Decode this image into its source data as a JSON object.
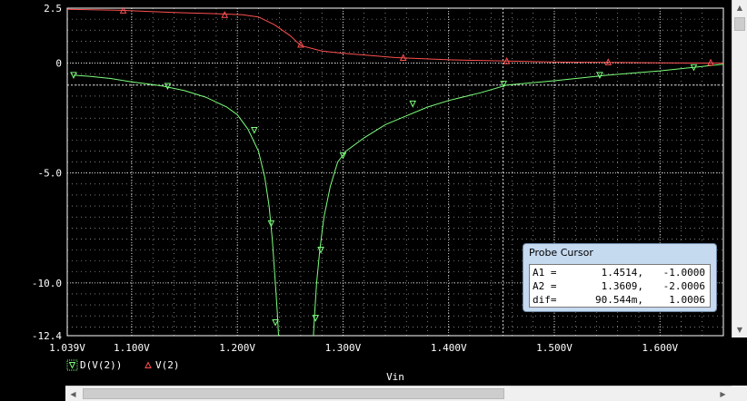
{
  "colors": {
    "background": "#000000",
    "grid": "#ffffff",
    "derivative_trace": "#7cff7c",
    "voltage_trace": "#ff5050",
    "cursor_line": "#ffffff",
    "probe_panel": "#c5d9ef"
  },
  "chart_data": {
    "type": "line",
    "xlabel": "Vin",
    "ylabel": "",
    "xlim": [
      1.039,
      1.66
    ],
    "ylim": [
      -12.4,
      2.5
    ],
    "grid": true,
    "legend_placement": "bottom-left",
    "x_tick_values": [
      1.1,
      1.2,
      1.3,
      1.4,
      1.5,
      1.6
    ],
    "x_tick_labels": [
      "1.039V",
      "1.100V",
      "1.200V",
      "1.300V",
      "1.400V",
      "1.500V",
      "1.600V"
    ],
    "x_label_values": [
      1.039,
      1.1,
      1.2,
      1.3,
      1.4,
      1.5,
      1.6
    ],
    "y_tick_values": [
      2.5,
      0,
      -5.0,
      -10.0,
      -12.4
    ],
    "y_tick_labels": [
      "2.5",
      "0",
      "-5.0",
      "-10.0",
      "-12.4"
    ],
    "cursors": [
      {
        "name": "A1",
        "x": 1.4514,
        "y": -1.0
      },
      {
        "name": "A2",
        "x": 1.3609,
        "y": -2.0006
      }
    ],
    "series": [
      {
        "name": "D(V(2))",
        "marker": "triangle-down",
        "points": [
          [
            1.045,
            -0.55
          ],
          [
            1.06,
            -0.6
          ],
          [
            1.08,
            -0.7
          ],
          [
            1.1,
            -0.85
          ],
          [
            1.12,
            -0.98
          ],
          [
            1.13,
            -1.05
          ],
          [
            1.15,
            -1.25
          ],
          [
            1.17,
            -1.55
          ],
          [
            1.19,
            -2.0
          ],
          [
            1.2,
            -2.35
          ],
          [
            1.21,
            -3.0
          ],
          [
            1.22,
            -4.0
          ],
          [
            1.226,
            -5.2
          ],
          [
            1.23,
            -6.5
          ],
          [
            1.233,
            -8.0
          ],
          [
            1.236,
            -10.0
          ],
          [
            1.238,
            -11.5
          ],
          [
            1.239,
            -12.4
          ]
        ],
        "points_right": [
          [
            1.272,
            -12.4
          ],
          [
            1.273,
            -11.5
          ],
          [
            1.275,
            -10.0
          ],
          [
            1.278,
            -8.5
          ],
          [
            1.282,
            -7.0
          ],
          [
            1.288,
            -5.6
          ],
          [
            1.295,
            -4.5
          ],
          [
            1.303,
            -4.0
          ],
          [
            1.32,
            -3.4
          ],
          [
            1.34,
            -2.8
          ],
          [
            1.36,
            -2.4
          ],
          [
            1.38,
            -2.0
          ],
          [
            1.4,
            -1.7
          ],
          [
            1.43,
            -1.35
          ],
          [
            1.455,
            -1.0
          ],
          [
            1.5,
            -0.8
          ],
          [
            1.55,
            -0.55
          ],
          [
            1.6,
            -0.35
          ],
          [
            1.64,
            -0.15
          ],
          [
            1.66,
            -0.05
          ]
        ],
        "markers": [
          [
            1.045,
            -0.55
          ],
          [
            1.134,
            -1.05
          ],
          [
            1.216,
            -3.05
          ],
          [
            1.232,
            -7.3
          ],
          [
            1.236,
            -11.8
          ],
          [
            1.274,
            -11.6
          ],
          [
            1.279,
            -8.5
          ],
          [
            1.3,
            -4.2
          ],
          [
            1.366,
            -1.85
          ],
          [
            1.452,
            -0.95
          ],
          [
            1.543,
            -0.55
          ],
          [
            1.632,
            -0.2
          ]
        ]
      },
      {
        "name": "V(2)",
        "marker": "triangle-up",
        "points": [
          [
            1.039,
            2.45
          ],
          [
            1.09,
            2.4
          ],
          [
            1.14,
            2.3
          ],
          [
            1.18,
            2.25
          ],
          [
            1.205,
            2.2
          ],
          [
            1.22,
            2.1
          ],
          [
            1.235,
            1.75
          ],
          [
            1.25,
            1.25
          ],
          [
            1.26,
            0.8
          ],
          [
            1.28,
            0.55
          ],
          [
            1.3,
            0.45
          ],
          [
            1.35,
            0.25
          ],
          [
            1.4,
            0.15
          ],
          [
            1.45,
            0.1
          ],
          [
            1.5,
            0.05
          ],
          [
            1.55,
            0.03
          ],
          [
            1.6,
            0.01
          ],
          [
            1.66,
            0.0
          ]
        ],
        "markers": [
          [
            1.092,
            2.4
          ],
          [
            1.188,
            2.2
          ],
          [
            1.26,
            0.85
          ],
          [
            1.357,
            0.25
          ],
          [
            1.455,
            0.1
          ],
          [
            1.551,
            0.05
          ],
          [
            1.648,
            0.03
          ]
        ]
      }
    ]
  },
  "legend": {
    "items": [
      {
        "label": "D(V(2))"
      },
      {
        "label": "V(2)"
      }
    ]
  },
  "probe_cursor": {
    "title": "Probe Cursor",
    "rows": [
      {
        "label": "A1 =",
        "v1": "1.4514,",
        "v2": "-1.0000"
      },
      {
        "label": "A2 =",
        "v1": "1.3609,",
        "v2": "-2.0006"
      },
      {
        "label": "dif=",
        "v1": "90.544m,",
        "v2": "1.0006"
      }
    ]
  },
  "scrollbars": {
    "up_icon": "▲",
    "down_icon": "▼",
    "left_icon": "◀",
    "right_icon": "▶"
  }
}
